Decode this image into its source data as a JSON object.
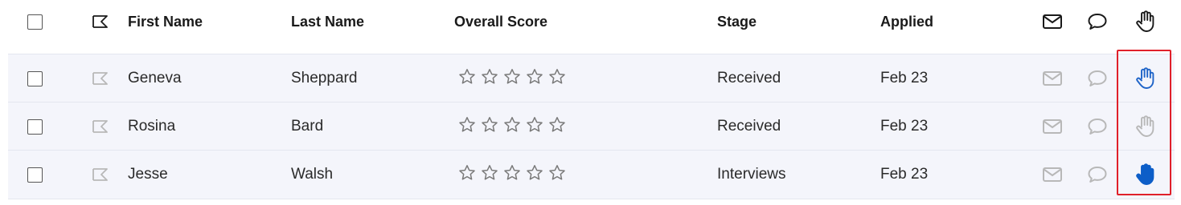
{
  "columns": {
    "first_name": "First Name",
    "last_name": "Last Name",
    "overall_score": "Overall Score",
    "stage": "Stage",
    "applied": "Applied"
  },
  "colors": {
    "header_icon": "#1a1a1a",
    "row_icon_muted": "#b8b8b8",
    "raise_outline_blue": "#1f64c8",
    "raise_filled_blue": "#0d5ec8",
    "highlight_border": "#e0202a"
  },
  "rows": [
    {
      "first_name": "Geneva",
      "last_name": "Sheppard",
      "stage": "Received",
      "applied": "Feb 23",
      "score_stars": 5,
      "raise_hand_state": "outline-blue"
    },
    {
      "first_name": "Rosina",
      "last_name": "Bard",
      "stage": "Received",
      "applied": "Feb 23",
      "score_stars": 5,
      "raise_hand_state": "outline-gray"
    },
    {
      "first_name": "Jesse",
      "last_name": "Walsh",
      "stage": "Interviews",
      "applied": "Feb 23",
      "score_stars": 5,
      "raise_hand_state": "filled-blue"
    }
  ],
  "icons": {
    "flag": "flag-icon",
    "mail": "mail-icon",
    "comment": "comment-icon",
    "raise_hand": "raise-hand-icon",
    "star": "star-icon"
  }
}
